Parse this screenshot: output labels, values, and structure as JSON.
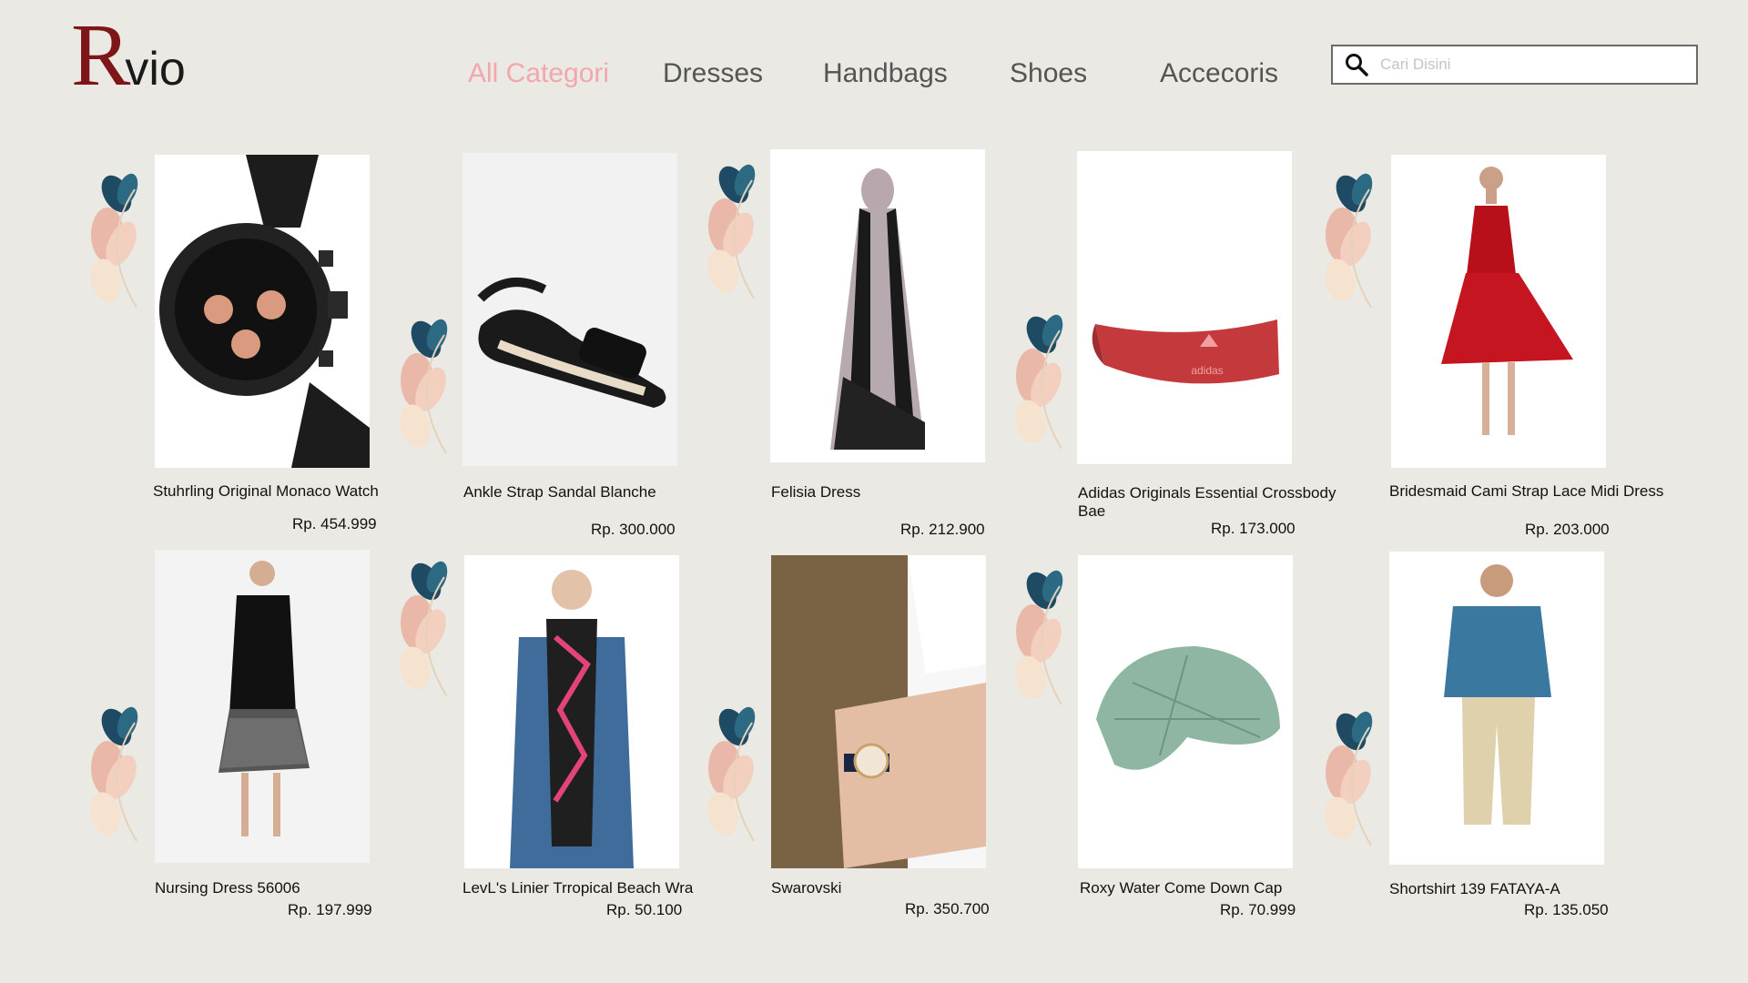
{
  "brand": {
    "initial": "R",
    "rest": "vio"
  },
  "nav": [
    {
      "label": "All Categori"
    },
    {
      "label": "Dresses"
    },
    {
      "label": "Handbags"
    },
    {
      "label": "Shoes"
    },
    {
      "label": "Accecoris"
    }
  ],
  "search": {
    "placeholder": "Cari Disini",
    "icon": "search-icon"
  },
  "products": [
    {
      "name": "Stuhrling Original Monaco Watch",
      "price": "Rp. 454.999",
      "icon": "watch-image"
    },
    {
      "name": "Ankle Strap Sandal Blanche",
      "price": "Rp. 300.000",
      "icon": "sandal-image"
    },
    {
      "name": "Felisia Dress",
      "price": "Rp. 212.900",
      "icon": "dress-image"
    },
    {
      "name": "Adidas Originals Essential Crossbody Bae",
      "price": "Rp. 173.000",
      "icon": "bag-image"
    },
    {
      "name": "Bridesmaid Cami Strap Lace Midi Dress",
      "price": "Rp. 203.000",
      "icon": "red-dress-image"
    },
    {
      "name": "Nursing Dress 56006",
      "price": "Rp. 197.999",
      "icon": "nursing-dress-image"
    },
    {
      "name": "LevL's Linier Trropical Beach Wra",
      "price": "Rp. 50.100",
      "icon": "scarf-image"
    },
    {
      "name": "Swarovski",
      "price": "Rp. 350.700",
      "icon": "wristwatch-image"
    },
    {
      "name": "Roxy Water Come Down Cap",
      "price": "Rp. 70.999",
      "icon": "cap-image"
    },
    {
      "name": "Shortshirt 139 FATAYA-A",
      "price": "Rp. 135.050",
      "icon": "shirt-image"
    }
  ],
  "colors": {
    "brand": "#7e1518",
    "active_nav": "#f2a7ad",
    "background": "#ebe9e4"
  }
}
